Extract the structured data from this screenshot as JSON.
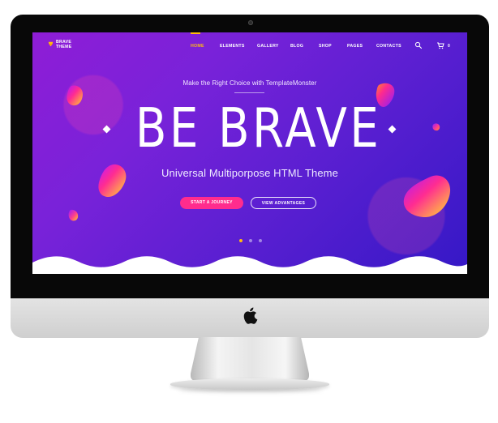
{
  "screen": {
    "brand": {
      "line1": "BRAVE",
      "line2": "THEME",
      "logo_icon": "gem-logo-icon"
    },
    "navigation": {
      "items": [
        {
          "label": "HOME",
          "active": true
        },
        {
          "label": "ELEMENTS",
          "active": false
        },
        {
          "label": "GALLERY",
          "active": false
        },
        {
          "label": "BLOG",
          "active": false
        },
        {
          "label": "SHOP",
          "active": false
        },
        {
          "label": "PAGES",
          "active": false
        },
        {
          "label": "CONTACTS",
          "active": false
        }
      ],
      "search_icon": "search-icon",
      "cart_icon": "shopping-cart-icon",
      "cart_count": "0"
    },
    "hero": {
      "eyebrow": "Make the Right Choice with TemplateMonster",
      "title": "BE BRAVE",
      "subtitle": "Universal Multiporpose HTML Theme",
      "primary_button": "START A JOURNEY",
      "secondary_button": "VIEW ADVANTAGES",
      "slider_dots": 3,
      "active_slide": 1
    },
    "colors": {
      "accent_yellow": "#ffbc0f",
      "accent_pink": "#ff2c8d",
      "gradient_start": "#8f1dd6",
      "gradient_end": "#3518c6"
    }
  },
  "device": {
    "logo_icon": "apple-logo-icon"
  }
}
